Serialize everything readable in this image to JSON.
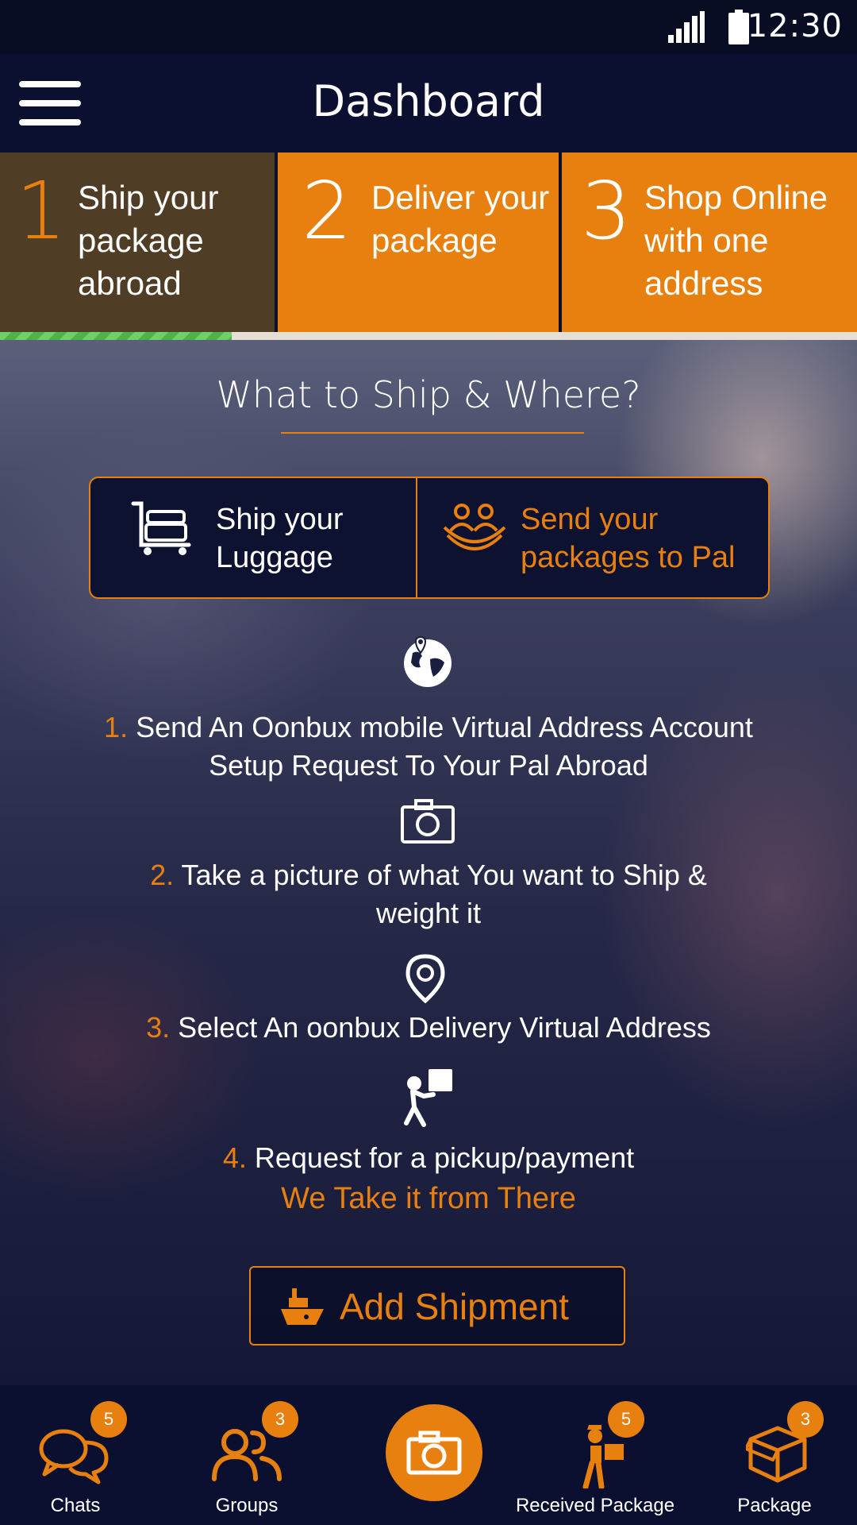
{
  "status": {
    "time": "12:30"
  },
  "header": {
    "title": "Dashboard"
  },
  "steps": [
    {
      "number": "1",
      "label": "Ship your package abroad"
    },
    {
      "number": "2",
      "label": "Deliver your package"
    },
    {
      "number": "3",
      "label": "Shop Online with one address"
    }
  ],
  "progress": 0.27,
  "hero": {
    "title": "What to Ship & Where?",
    "options": [
      {
        "label_line1": "Ship your",
        "label_line2": "Luggage"
      },
      {
        "label_line1": "Send your",
        "label_line2": "packages to Pal"
      }
    ],
    "items": [
      {
        "num": "1.",
        "line1": "Send An Oonbux mobile Virtual Address Account",
        "line2": "Setup Request To Your Pal Abroad"
      },
      {
        "num": "2.",
        "line1": "Take a picture of what You want to Ship &",
        "line2": "weight it"
      },
      {
        "num": "3.",
        "line1": "Select An oonbux Delivery Virtual Address"
      },
      {
        "num": "4.",
        "line1": "Request for a pickup/payment"
      }
    ],
    "tagline": "We Take it from There",
    "add_shipment": "Add Shipment"
  },
  "nav": {
    "chats": {
      "label": "Chats",
      "badge": "5"
    },
    "groups": {
      "label": "Groups",
      "badge": "3"
    },
    "received": {
      "label": "Received Package",
      "badge": "5"
    },
    "package": {
      "label": "Package",
      "badge": "3"
    }
  },
  "colors": {
    "accent": "#e8800f",
    "dark": "#0c1130",
    "brown": "#4f3d25",
    "progress": "#5cc257"
  }
}
